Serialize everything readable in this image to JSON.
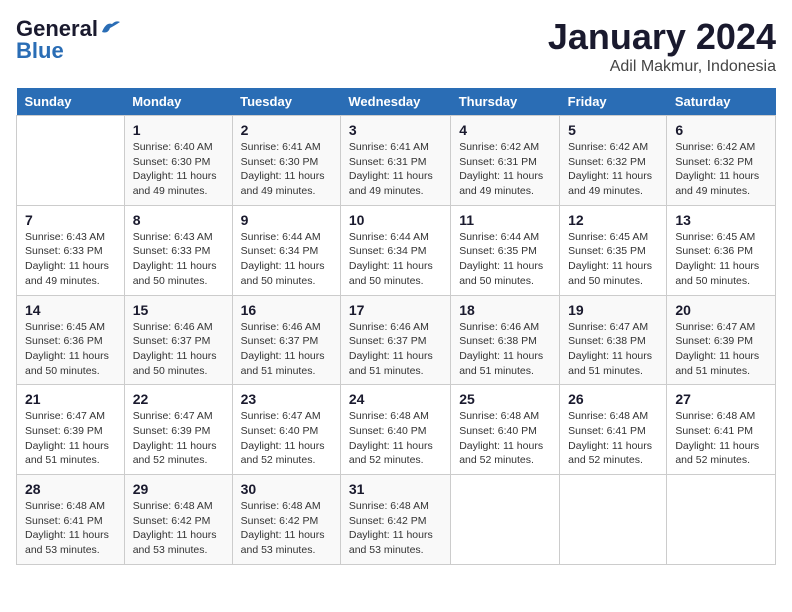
{
  "logo": {
    "line1": "General",
    "line2": "Blue"
  },
  "title": "January 2024",
  "subtitle": "Adil Makmur, Indonesia",
  "days_header": [
    "Sunday",
    "Monday",
    "Tuesday",
    "Wednesday",
    "Thursday",
    "Friday",
    "Saturday"
  ],
  "weeks": [
    [
      {
        "num": "",
        "info": ""
      },
      {
        "num": "1",
        "info": "Sunrise: 6:40 AM\nSunset: 6:30 PM\nDaylight: 11 hours\nand 49 minutes."
      },
      {
        "num": "2",
        "info": "Sunrise: 6:41 AM\nSunset: 6:30 PM\nDaylight: 11 hours\nand 49 minutes."
      },
      {
        "num": "3",
        "info": "Sunrise: 6:41 AM\nSunset: 6:31 PM\nDaylight: 11 hours\nand 49 minutes."
      },
      {
        "num": "4",
        "info": "Sunrise: 6:42 AM\nSunset: 6:31 PM\nDaylight: 11 hours\nand 49 minutes."
      },
      {
        "num": "5",
        "info": "Sunrise: 6:42 AM\nSunset: 6:32 PM\nDaylight: 11 hours\nand 49 minutes."
      },
      {
        "num": "6",
        "info": "Sunrise: 6:42 AM\nSunset: 6:32 PM\nDaylight: 11 hours\nand 49 minutes."
      }
    ],
    [
      {
        "num": "7",
        "info": "Sunrise: 6:43 AM\nSunset: 6:33 PM\nDaylight: 11 hours\nand 49 minutes."
      },
      {
        "num": "8",
        "info": "Sunrise: 6:43 AM\nSunset: 6:33 PM\nDaylight: 11 hours\nand 50 minutes."
      },
      {
        "num": "9",
        "info": "Sunrise: 6:44 AM\nSunset: 6:34 PM\nDaylight: 11 hours\nand 50 minutes."
      },
      {
        "num": "10",
        "info": "Sunrise: 6:44 AM\nSunset: 6:34 PM\nDaylight: 11 hours\nand 50 minutes."
      },
      {
        "num": "11",
        "info": "Sunrise: 6:44 AM\nSunset: 6:35 PM\nDaylight: 11 hours\nand 50 minutes."
      },
      {
        "num": "12",
        "info": "Sunrise: 6:45 AM\nSunset: 6:35 PM\nDaylight: 11 hours\nand 50 minutes."
      },
      {
        "num": "13",
        "info": "Sunrise: 6:45 AM\nSunset: 6:36 PM\nDaylight: 11 hours\nand 50 minutes."
      }
    ],
    [
      {
        "num": "14",
        "info": "Sunrise: 6:45 AM\nSunset: 6:36 PM\nDaylight: 11 hours\nand 50 minutes."
      },
      {
        "num": "15",
        "info": "Sunrise: 6:46 AM\nSunset: 6:37 PM\nDaylight: 11 hours\nand 50 minutes."
      },
      {
        "num": "16",
        "info": "Sunrise: 6:46 AM\nSunset: 6:37 PM\nDaylight: 11 hours\nand 51 minutes."
      },
      {
        "num": "17",
        "info": "Sunrise: 6:46 AM\nSunset: 6:37 PM\nDaylight: 11 hours\nand 51 minutes."
      },
      {
        "num": "18",
        "info": "Sunrise: 6:46 AM\nSunset: 6:38 PM\nDaylight: 11 hours\nand 51 minutes."
      },
      {
        "num": "19",
        "info": "Sunrise: 6:47 AM\nSunset: 6:38 PM\nDaylight: 11 hours\nand 51 minutes."
      },
      {
        "num": "20",
        "info": "Sunrise: 6:47 AM\nSunset: 6:39 PM\nDaylight: 11 hours\nand 51 minutes."
      }
    ],
    [
      {
        "num": "21",
        "info": "Sunrise: 6:47 AM\nSunset: 6:39 PM\nDaylight: 11 hours\nand 51 minutes."
      },
      {
        "num": "22",
        "info": "Sunrise: 6:47 AM\nSunset: 6:39 PM\nDaylight: 11 hours\nand 52 minutes."
      },
      {
        "num": "23",
        "info": "Sunrise: 6:47 AM\nSunset: 6:40 PM\nDaylight: 11 hours\nand 52 minutes."
      },
      {
        "num": "24",
        "info": "Sunrise: 6:48 AM\nSunset: 6:40 PM\nDaylight: 11 hours\nand 52 minutes."
      },
      {
        "num": "25",
        "info": "Sunrise: 6:48 AM\nSunset: 6:40 PM\nDaylight: 11 hours\nand 52 minutes."
      },
      {
        "num": "26",
        "info": "Sunrise: 6:48 AM\nSunset: 6:41 PM\nDaylight: 11 hours\nand 52 minutes."
      },
      {
        "num": "27",
        "info": "Sunrise: 6:48 AM\nSunset: 6:41 PM\nDaylight: 11 hours\nand 52 minutes."
      }
    ],
    [
      {
        "num": "28",
        "info": "Sunrise: 6:48 AM\nSunset: 6:41 PM\nDaylight: 11 hours\nand 53 minutes."
      },
      {
        "num": "29",
        "info": "Sunrise: 6:48 AM\nSunset: 6:42 PM\nDaylight: 11 hours\nand 53 minutes."
      },
      {
        "num": "30",
        "info": "Sunrise: 6:48 AM\nSunset: 6:42 PM\nDaylight: 11 hours\nand 53 minutes."
      },
      {
        "num": "31",
        "info": "Sunrise: 6:48 AM\nSunset: 6:42 PM\nDaylight: 11 hours\nand 53 minutes."
      },
      {
        "num": "",
        "info": ""
      },
      {
        "num": "",
        "info": ""
      },
      {
        "num": "",
        "info": ""
      }
    ]
  ]
}
